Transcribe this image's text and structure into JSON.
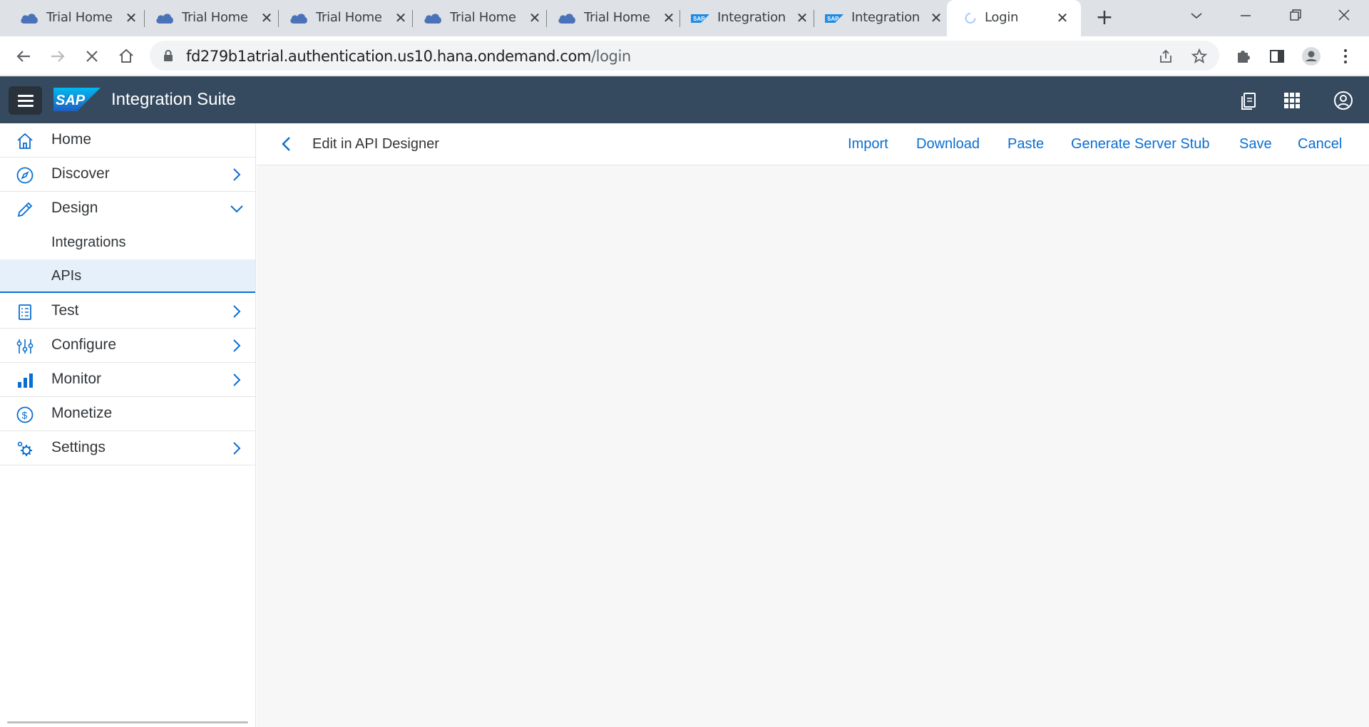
{
  "browser": {
    "tabs": [
      {
        "title": "Trial Home",
        "icon": "cloud-icon"
      },
      {
        "title": "Trial Home",
        "icon": "cloud-icon"
      },
      {
        "title": "Trial Home",
        "icon": "cloud-icon"
      },
      {
        "title": "Trial Home",
        "icon": "cloud-icon"
      },
      {
        "title": "Trial Home",
        "icon": "cloud-icon"
      },
      {
        "title": "Integration",
        "icon": "sap-icon"
      },
      {
        "title": "Integration",
        "icon": "sap-icon"
      },
      {
        "title": "Login",
        "icon": "loading-spinner-icon"
      }
    ],
    "close_glyph": "✕",
    "new_tab_glyph": "+",
    "url_host": "fd279b1atrial.authentication.us10.hana.ondemand.com",
    "url_path": "/login"
  },
  "shell": {
    "app_title": "Integration Suite",
    "brand_color": "#354a5f"
  },
  "sidenav": {
    "items": [
      {
        "label": "Home",
        "icon": "home-icon"
      },
      {
        "label": "Discover",
        "icon": "compass-icon"
      },
      {
        "label": "Design",
        "icon": "pencil-icon"
      },
      {
        "label": "Test",
        "icon": "checklist-icon"
      },
      {
        "label": "Configure",
        "icon": "sliders-icon"
      },
      {
        "label": "Monitor",
        "icon": "bar-chart-icon"
      },
      {
        "label": "Monetize",
        "icon": "dollar-icon"
      },
      {
        "label": "Settings",
        "icon": "gears-icon"
      }
    ],
    "design_children": [
      {
        "label": "Integrations"
      },
      {
        "label": "APIs"
      }
    ],
    "selected": "APIs",
    "accent_color": "#0a6ed1"
  },
  "page": {
    "title": "Edit in API Designer",
    "actions": {
      "import": "Import",
      "download": "Download",
      "paste": "Paste",
      "generate": "Generate Server Stub",
      "save": "Save",
      "cancel": "Cancel"
    }
  }
}
